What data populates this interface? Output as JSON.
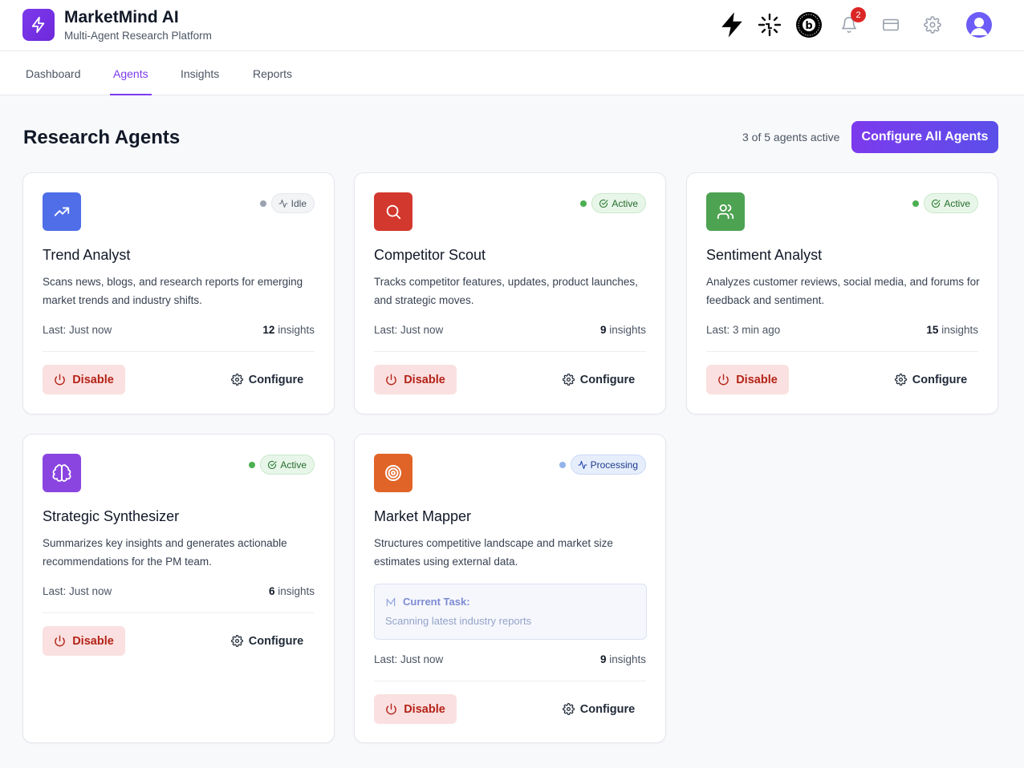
{
  "app": {
    "title": "MarketMind AI",
    "subtitle": "Multi-Agent Research Platform",
    "notification_count": "2",
    "accent_color": "#7c3aed"
  },
  "header_icons": [
    "bolt-icon",
    "pulse-indicator-icon",
    "b-badge-icon",
    "bell-icon",
    "card-icon",
    "gear-icon",
    "user-avatar"
  ],
  "tabs": [
    {
      "label": "Dashboard",
      "active": false
    },
    {
      "label": "Agents",
      "active": true
    },
    {
      "label": "Insights",
      "active": false
    },
    {
      "label": "Reports",
      "active": false
    }
  ],
  "page": {
    "title": "Research Agents",
    "active_count": "3 of 5 agents active",
    "configure_all_label": "Configure All Agents"
  },
  "agents": [
    {
      "name": "Trend Analyst",
      "icon": "trending-up-icon",
      "icon_color": "#4f6ee8",
      "status": "Idle",
      "description": "Scans news, blogs, and research reports for emerging market trends and industry shifts.",
      "last": "Last: Just now",
      "insights_count": "12",
      "insights_label": "insights",
      "disable_label": "Disable",
      "configure_label": "Configure"
    },
    {
      "name": "Competitor Scout",
      "icon": "search-icon",
      "icon_color": "#d3382e",
      "status": "Active",
      "description": "Tracks competitor features, updates, product launches, and strategic moves.",
      "last": "Last: Just now",
      "insights_count": "9",
      "insights_label": "insights",
      "disable_label": "Disable",
      "configure_label": "Configure"
    },
    {
      "name": "Sentiment Analyst",
      "icon": "users-icon",
      "icon_color": "#4ea352",
      "status": "Active",
      "description": "Analyzes customer reviews, social media, and forums for feedback and sentiment.",
      "last": "Last: 3 min ago",
      "insights_count": "15",
      "insights_label": "insights",
      "disable_label": "Disable",
      "configure_label": "Configure"
    },
    {
      "name": "Strategic Synthesizer",
      "icon": "brain-icon",
      "icon_color": "#8a45e0",
      "status": "Active",
      "description": "Summarizes key insights and generates actionable recommendations for the PM team.",
      "last": "Last: Just now",
      "insights_count": "6",
      "insights_label": "insights",
      "disable_label": "Disable",
      "configure_label": "Configure"
    },
    {
      "name": "Market Mapper",
      "icon": "target-icon",
      "icon_color": "#e06427",
      "status": "Processing",
      "description": "Structures competitive landscape and market size estimates using external data.",
      "current_task_label": "Current Task:",
      "current_task": "Scanning latest industry reports",
      "last": "Last: Just now",
      "insights_count": "9",
      "insights_label": "insights",
      "disable_label": "Disable",
      "configure_label": "Configure"
    }
  ]
}
